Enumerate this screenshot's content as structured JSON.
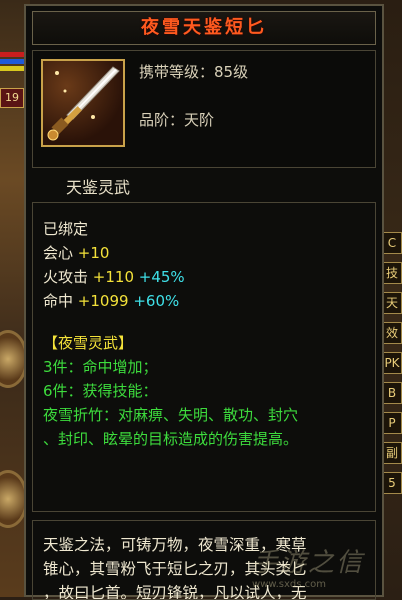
{
  "item": {
    "name": "夜雪天鉴短匕",
    "required_level": "携带等级：85级",
    "grade": "品阶：天阶",
    "category": "天鉴灵武",
    "icon": "dagger-icon"
  },
  "stats": {
    "bound": "已绑定",
    "crit": {
      "label": "会心",
      "value": "+10"
    },
    "fire_attack": {
      "label": "火攻击",
      "value": "+110",
      "bonus": "+45%"
    },
    "hit": {
      "label": "命中",
      "value": "+1099",
      "bonus": "+60%"
    }
  },
  "set": {
    "name": "【夜雪灵武】",
    "piece3": "3件：命中增加；",
    "piece6": "6件：获得技能：",
    "skill_line1": "夜雪折竹：对麻痹、失明、散功、封穴",
    "skill_line2": "、封印、眩晕的目标造成的伤害提高。"
  },
  "description": {
    "line1": "天鉴之法，可铸万物，夜雪深重，寒草",
    "line2": "锥心，其雪粉飞于短匕之刃，其头类匕",
    "line3": "，故曰匕首。短刃锋锐，凡以试人，无"
  },
  "hud": {
    "level": "19",
    "right_tabs": [
      "C",
      "技",
      "天",
      "效",
      "PK",
      "B",
      "P",
      "副",
      "5"
    ]
  },
  "watermark": {
    "text": "www.sxds.com",
    "brand": "手游之信"
  },
  "colors": {
    "title": "#ff5a1f",
    "stat_value": "#f4e23a",
    "stat_bonus": "#3fe0e8",
    "set_text": "#3ddc3d",
    "frame_gold": "#c9a24a"
  }
}
